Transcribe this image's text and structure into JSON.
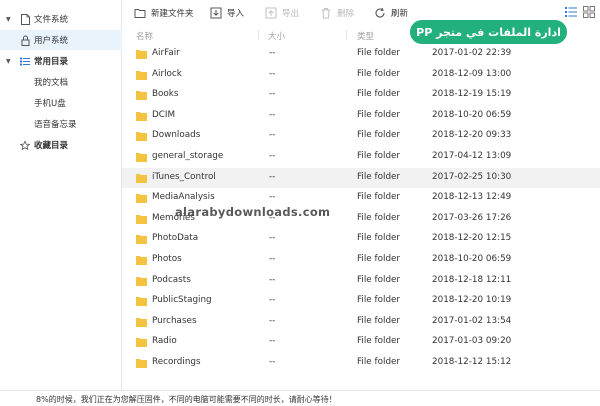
{
  "sidebar": {
    "file_system": "文件系统",
    "user_system": "用户系统",
    "common_dirs": "常用目录",
    "my_docs": "我的文档",
    "phone_u": "手机U盘",
    "voice_memo": "语音备忘录",
    "favorites": "收藏目录"
  },
  "toolbar": {
    "new_folder": "新建文件夹",
    "import": "导入",
    "export": "导出",
    "delete": "删除",
    "refresh": "刷新"
  },
  "banner": {
    "text": "ادارة الملفات في متجر PP"
  },
  "columns": {
    "name": "名称",
    "size": "大小",
    "type": "类型"
  },
  "files": [
    {
      "name": "AirFair",
      "size": "--",
      "type": "File folder",
      "date": "2017-01-02 22:39"
    },
    {
      "name": "Airlock",
      "size": "--",
      "type": "File folder",
      "date": "2018-12-09 13:00"
    },
    {
      "name": "Books",
      "size": "--",
      "type": "File folder",
      "date": "2018-12-19 15:19"
    },
    {
      "name": "DCIM",
      "size": "--",
      "type": "File folder",
      "date": "2018-10-20 06:59"
    },
    {
      "name": "Downloads",
      "size": "--",
      "type": "File folder",
      "date": "2018-12-20 09:33"
    },
    {
      "name": "general_storage",
      "size": "--",
      "type": "File folder",
      "date": "2017-04-12 13:09"
    },
    {
      "name": "iTunes_Control",
      "size": "--",
      "type": "File folder",
      "date": "2017-02-25 10:30"
    },
    {
      "name": "MediaAnalysis",
      "size": "--",
      "type": "File folder",
      "date": "2018-12-13 12:49"
    },
    {
      "name": "Memories",
      "size": "--",
      "type": "File folder",
      "date": "2017-03-26 17:26"
    },
    {
      "name": "PhotoData",
      "size": "--",
      "type": "File folder",
      "date": "2018-12-20 12:15"
    },
    {
      "name": "Photos",
      "size": "--",
      "type": "File folder",
      "date": "2018-10-20 06:59"
    },
    {
      "name": "Podcasts",
      "size": "--",
      "type": "File folder",
      "date": "2018-12-18 12:11"
    },
    {
      "name": "PublicStaging",
      "size": "--",
      "type": "File folder",
      "date": "2018-12-20 10:19"
    },
    {
      "name": "Purchases",
      "size": "--",
      "type": "File folder",
      "date": "2017-01-02 13:54"
    },
    {
      "name": "Radio",
      "size": "--",
      "type": "File folder",
      "date": "2017-01-03 09:20"
    },
    {
      "name": "Recordings",
      "size": "--",
      "type": "File folder",
      "date": "2018-12-12 15:12"
    }
  ],
  "watermark": "alarabydownloads.com",
  "status": {
    "text": "8%的时候，我们正在为您解压固件，不同的电脑可能需要不同的时长，请耐心等待！"
  },
  "colors": {
    "banner": "#22b07d",
    "folder": "#f5c342",
    "selected": "#e8f3fb",
    "accent": "#2c7cd6"
  }
}
